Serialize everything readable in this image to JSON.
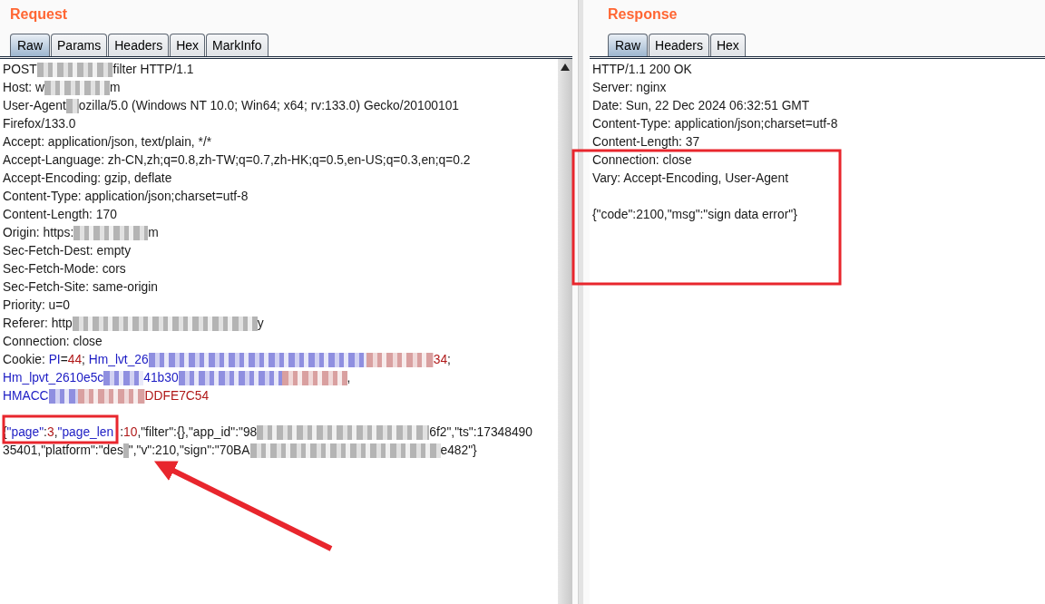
{
  "request": {
    "title": "Request",
    "tabs": [
      {
        "label": "Raw",
        "selected": true
      },
      {
        "label": "Params",
        "selected": false
      },
      {
        "label": "Headers",
        "selected": false
      },
      {
        "label": "Hex",
        "selected": false
      },
      {
        "label": "MarkInfo",
        "selected": false
      }
    ],
    "lines": [
      {
        "kind": "text",
        "parts": [
          {
            "kind": "text",
            "text": "POST"
          },
          {
            "kind": "redacted",
            "color": "#b4b4b4"
          },
          {
            "kind": "text",
            "text": "filter HTTP/1.1"
          }
        ]
      },
      {
        "kind": "text",
        "parts": [
          {
            "kind": "text",
            "text": "Host: w"
          },
          {
            "kind": "redacted",
            "color": "#b4b4b4"
          },
          {
            "kind": "text",
            "text": "m"
          }
        ]
      },
      {
        "kind": "text",
        "parts": [
          {
            "kind": "text",
            "text": "User-Agent"
          },
          {
            "kind": "redacted",
            "color": "#b4b4b4"
          },
          {
            "kind": "text",
            "text": "ozilla/5.0 (Windows NT 10.0; Win64; x64; rv:133.0) Gecko/20100101"
          }
        ]
      },
      {
        "kind": "text",
        "parts": [
          {
            "kind": "text",
            "text": "Firefox/133.0"
          }
        ]
      },
      {
        "kind": "text",
        "parts": [
          {
            "kind": "text",
            "text": "Accept: application/json, text/plain, */*"
          }
        ]
      },
      {
        "kind": "text",
        "parts": [
          {
            "kind": "text",
            "text": "Accept-Language: zh-CN,zh;q=0.8,zh-TW;q=0.7,zh-HK;q=0.5,en-US;q=0.3,en;q=0.2"
          }
        ]
      },
      {
        "kind": "text",
        "parts": [
          {
            "kind": "text",
            "text": "Accept-Encoding: gzip, deflate"
          }
        ]
      },
      {
        "kind": "text",
        "parts": [
          {
            "kind": "text",
            "text": "Content-Type: application/json;charset=utf-8"
          }
        ]
      },
      {
        "kind": "text",
        "parts": [
          {
            "kind": "text",
            "text": "Content-Length: 170"
          }
        ]
      },
      {
        "kind": "text",
        "parts": [
          {
            "kind": "text",
            "text": "Origin: https:"
          },
          {
            "kind": "redacted",
            "color": "#b4b4b4"
          },
          {
            "kind": "text",
            "text": "m"
          }
        ]
      },
      {
        "kind": "text",
        "parts": [
          {
            "kind": "text",
            "text": "Sec-Fetch-Dest: empty"
          }
        ]
      },
      {
        "kind": "text",
        "parts": [
          {
            "kind": "text",
            "text": "Sec-Fetch-Mode: cors"
          }
        ]
      },
      {
        "kind": "text",
        "parts": [
          {
            "kind": "text",
            "text": "Sec-Fetch-Site: same-origin"
          }
        ]
      },
      {
        "kind": "text",
        "parts": [
          {
            "kind": "text",
            "text": "Priority: u=0"
          }
        ]
      },
      {
        "kind": "text",
        "parts": [
          {
            "kind": "text",
            "text": "Referer: http"
          },
          {
            "kind": "redacted",
            "color": "#b4b4b4"
          },
          {
            "kind": "text",
            "text": "y"
          }
        ]
      },
      {
        "kind": "text",
        "parts": [
          {
            "kind": "text",
            "text": "Connection: close"
          }
        ]
      },
      {
        "kind": "text",
        "parts": [
          {
            "kind": "text",
            "text": "Cookie: "
          },
          {
            "kind": "key",
            "text": "PI"
          },
          {
            "kind": "text",
            "text": "="
          },
          {
            "kind": "value",
            "text": "44"
          },
          {
            "kind": "text",
            "text": "; "
          },
          {
            "kind": "key",
            "text": "Hm_lvt_26"
          },
          {
            "kind": "redacted",
            "color": "#8f8fe0"
          },
          {
            "kind": "redacted",
            "color": "#d9a0a0"
          },
          {
            "kind": "value",
            "text": "34"
          },
          {
            "kind": "text",
            "text": ";"
          }
        ]
      },
      {
        "kind": "text",
        "parts": [
          {
            "kind": "key",
            "text": "Hm_lpvt_2610e5c"
          },
          {
            "kind": "redacted",
            "color": "#8f8fe0"
          },
          {
            "kind": "key",
            "text": "41b30"
          },
          {
            "kind": "redacted",
            "color": "#8f8fe0"
          },
          {
            "kind": "redacted",
            "color": "#d9a0a0"
          },
          {
            "kind": "text",
            "text": ","
          }
        ]
      },
      {
        "kind": "text",
        "parts": [
          {
            "kind": "key",
            "text": "HMACC"
          },
          {
            "kind": "redacted",
            "color": "#8f8fe0"
          },
          {
            "kind": "redacted",
            "color": "#d9a0a0"
          },
          {
            "kind": "value",
            "text": "DDFE7C54"
          }
        ]
      },
      {
        "kind": "blank"
      },
      {
        "kind": "text",
        "parts": [
          {
            "kind": "text",
            "text": "{"
          },
          {
            "kind": "key",
            "text": "\"page\""
          },
          {
            "kind": "text",
            "text": ":"
          },
          {
            "kind": "value",
            "text": "3"
          },
          {
            "kind": "text",
            "text": ","
          },
          {
            "kind": "key",
            "text": "\"page_len"
          },
          {
            "kind": "covered"
          },
          {
            "kind": "text",
            "text": ":"
          },
          {
            "kind": "value",
            "text": "10"
          },
          {
            "kind": "text",
            "text": ",\"filter\":{},\"app_id\":\"98"
          },
          {
            "kind": "redacted",
            "color": "#b4b4b4"
          },
          {
            "kind": "text",
            "text": "6f2\",\"ts\":17348490"
          }
        ]
      },
      {
        "kind": "text",
        "parts": [
          {
            "kind": "text",
            "text": "35401,\"platform\":\"des"
          },
          {
            "kind": "redacted",
            "color": "#b4b4b4"
          },
          {
            "kind": "text",
            "text": "\",\"v\":210,\"sign\":\"70BA"
          },
          {
            "kind": "redacted",
            "color": "#b4b4b4"
          },
          {
            "kind": "text",
            "text": "e482\"}"
          }
        ]
      }
    ]
  },
  "response": {
    "title": "Response",
    "tabs": [
      {
        "label": "Raw",
        "selected": true
      },
      {
        "label": "Headers",
        "selected": false
      },
      {
        "label": "Hex",
        "selected": false
      }
    ],
    "lines": [
      {
        "kind": "text",
        "parts": [
          {
            "kind": "text",
            "text": "HTTP/1.1 200 OK"
          }
        ]
      },
      {
        "kind": "text",
        "parts": [
          {
            "kind": "text",
            "text": "Server: nginx"
          }
        ]
      },
      {
        "kind": "text",
        "parts": [
          {
            "kind": "text",
            "text": "Date: Sun, 22 Dec 2024 06:32:51 GMT"
          }
        ]
      },
      {
        "kind": "text",
        "parts": [
          {
            "kind": "text",
            "text": "Content-Type: application/json;charset=utf-8"
          }
        ]
      },
      {
        "kind": "text",
        "parts": [
          {
            "kind": "text",
            "text": "Content-Length: 37"
          }
        ]
      },
      {
        "kind": "text",
        "parts": [
          {
            "kind": "text",
            "text": "Connection: close"
          }
        ]
      },
      {
        "kind": "text",
        "parts": [
          {
            "kind": "text",
            "text": "Vary: Accept-Encoding, User-Agent"
          }
        ]
      },
      {
        "kind": "blank"
      },
      {
        "kind": "text",
        "parts": [
          {
            "kind": "text",
            "text": "{\"code\":2100,\"msg\":\"sign data error\"}"
          }
        ]
      }
    ]
  }
}
